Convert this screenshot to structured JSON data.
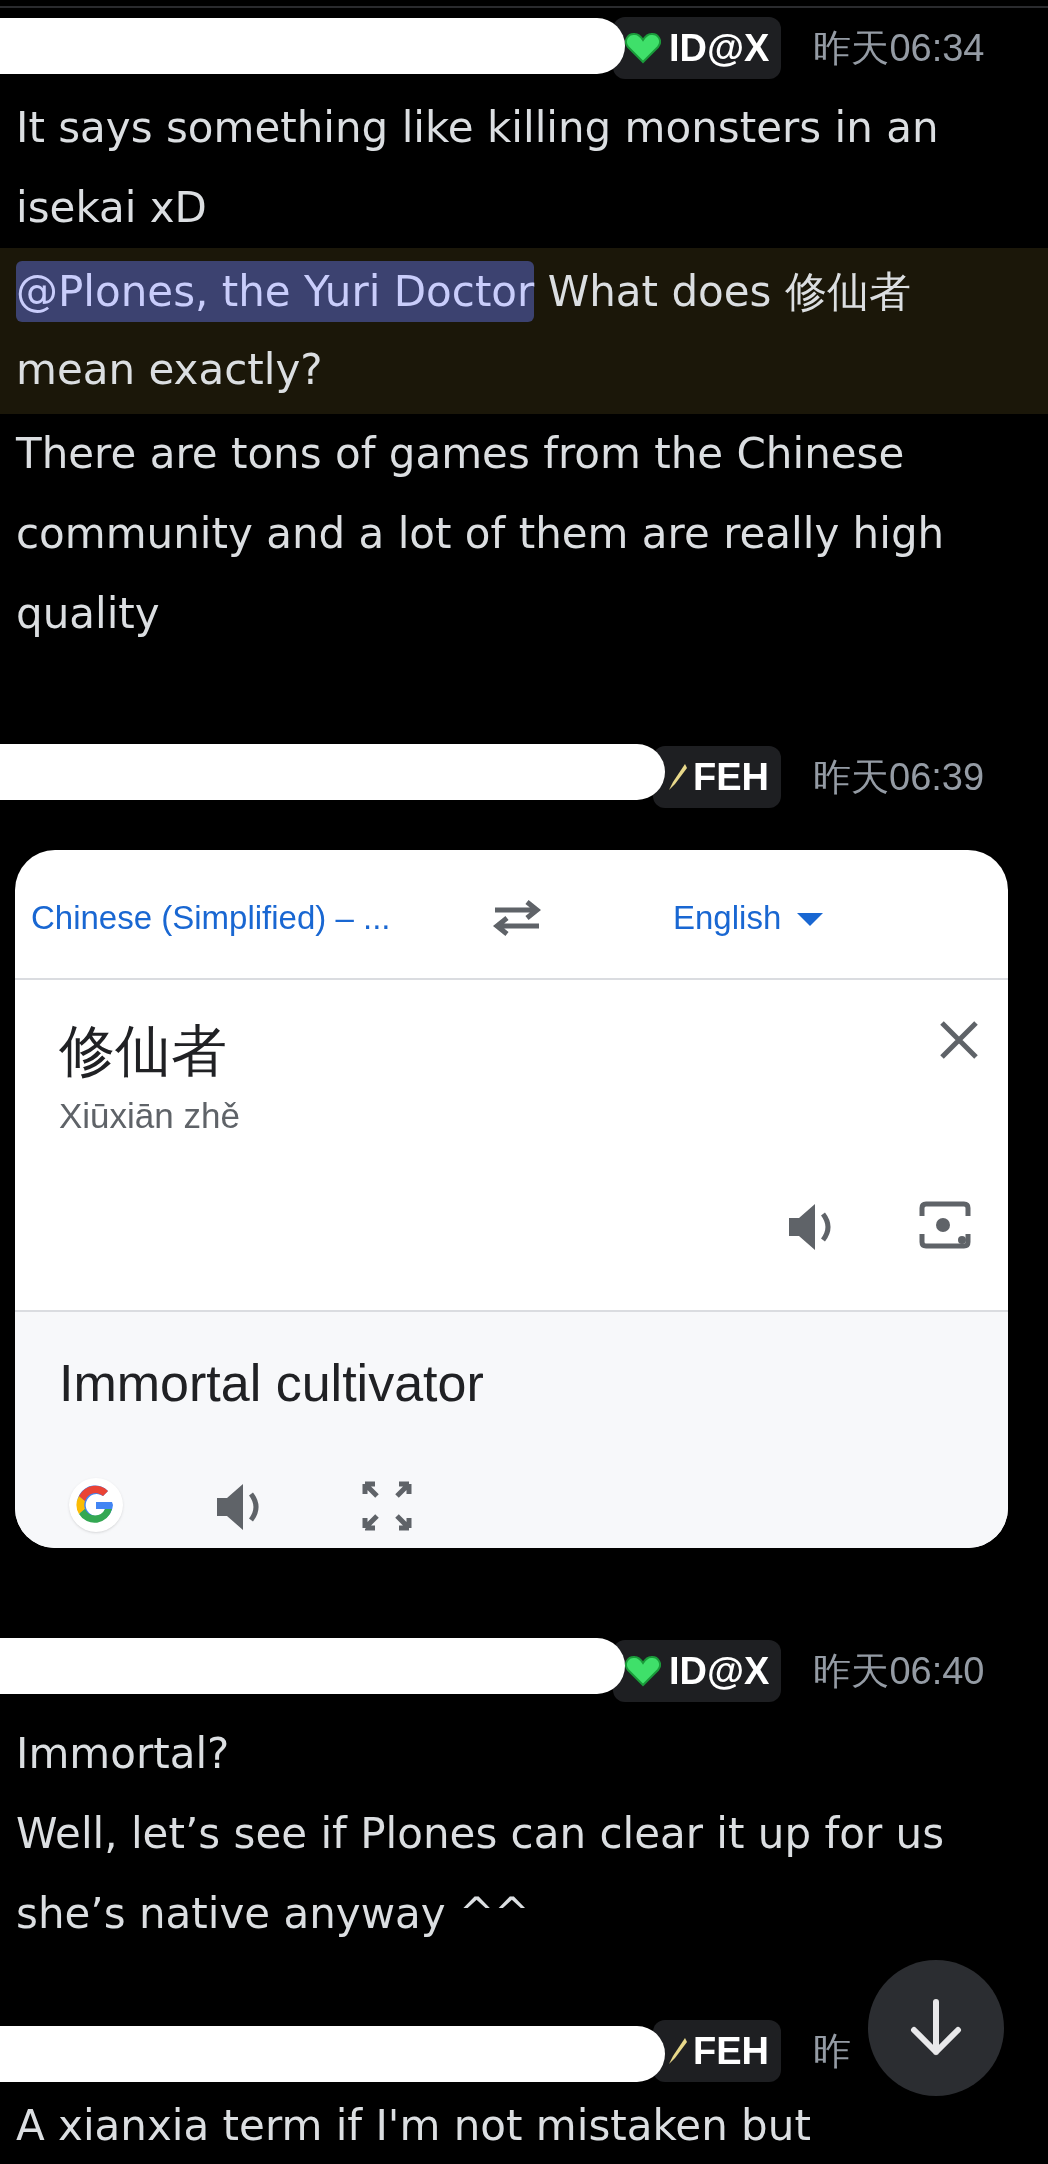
{
  "messages": [
    {
      "header": {
        "name_redacted": true,
        "badge": {
          "kind": "heart",
          "label": "ID@X"
        },
        "time": "昨天06:34"
      },
      "blocks": [
        {
          "kind": "text",
          "text": "It says something like killing monsters in an isekai xD"
        },
        {
          "kind": "mention",
          "mention": "@Plones, the Yuri Doctor",
          "text": " What does 修仙者 mean exactly?"
        },
        {
          "kind": "text",
          "text": "There are tons of games from the Chinese community and a lot of them are really high quality"
        }
      ]
    },
    {
      "header": {
        "name_redacted": true,
        "badge": {
          "kind": "sword",
          "label": "FEH"
        },
        "time": "昨天06:39"
      },
      "blocks": [
        {
          "kind": "translate_card",
          "source_language": "Chinese (Simplified) – ...",
          "target_language": "English",
          "source_text": "修仙者",
          "romanization": "Xiūxiān zhě",
          "translation": "Immortal cultivator"
        }
      ]
    },
    {
      "header": {
        "name_redacted": true,
        "badge": {
          "kind": "heart",
          "label": "ID@X"
        },
        "time": "昨天06:40"
      },
      "blocks": [
        {
          "kind": "text",
          "text": "Immortal?"
        },
        {
          "kind": "text",
          "text": "Well, let’s see if Plones can clear it up for us she’s native anyway ^^"
        }
      ]
    },
    {
      "header": {
        "name_redacted": true,
        "badge": {
          "kind": "sword",
          "label": "FEH"
        },
        "time": "昨"
      },
      "blocks": [
        {
          "kind": "text",
          "text": "A xianxia term if I'm not mistaken but"
        }
      ]
    }
  ]
}
